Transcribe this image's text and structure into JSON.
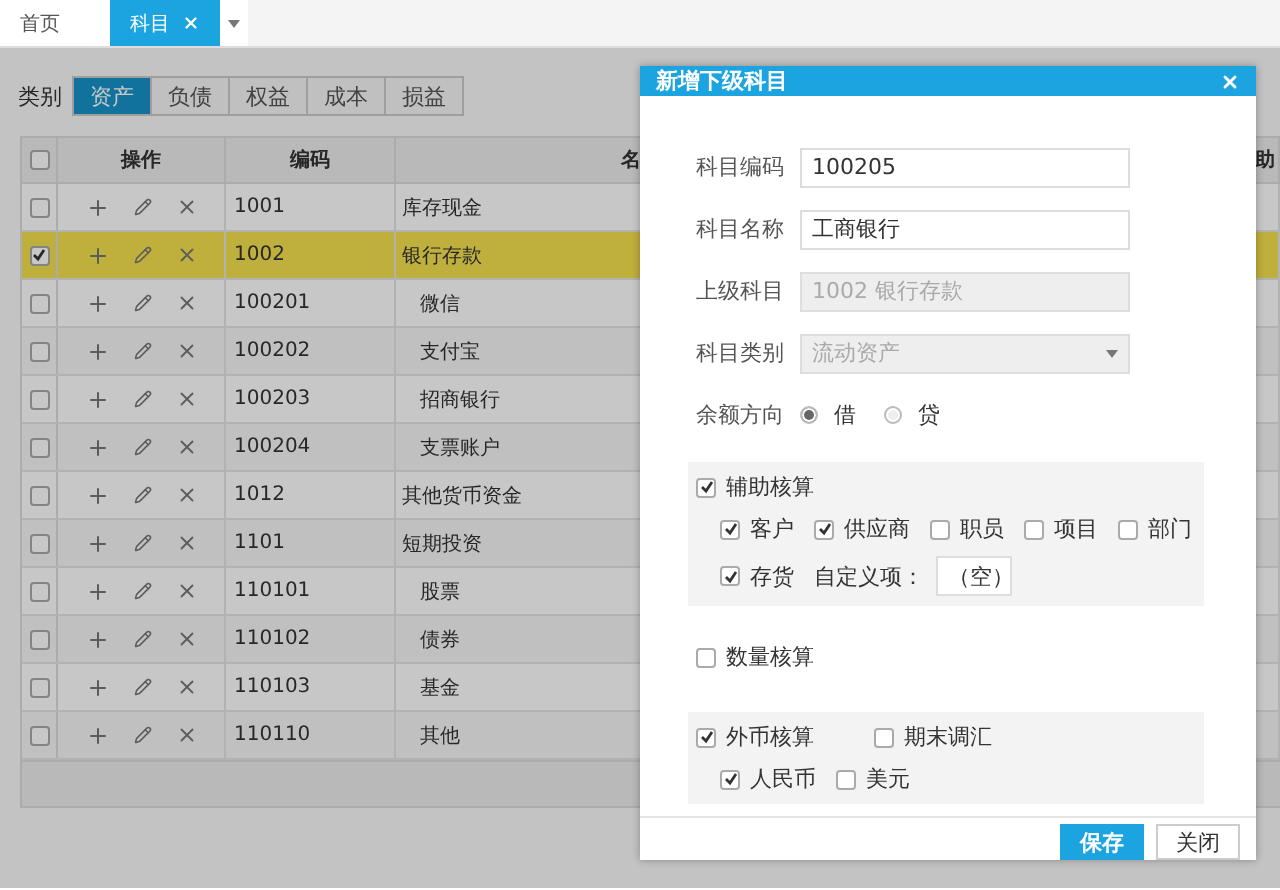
{
  "tabs": [
    {
      "label": "首页",
      "selected": false,
      "closable": false
    },
    {
      "label": "科目",
      "selected": true,
      "closable": true
    }
  ],
  "category_filter": {
    "label": "类别",
    "options": [
      {
        "label": "资产",
        "selected": true
      },
      {
        "label": "负债",
        "selected": false
      },
      {
        "label": "权益",
        "selected": false
      },
      {
        "label": "成本",
        "selected": false
      },
      {
        "label": "损益",
        "selected": false
      }
    ]
  },
  "table": {
    "all_checked": false,
    "columns": [
      "操作",
      "编码",
      "名",
      "助"
    ],
    "rows": [
      {
        "code": "1001",
        "name": "库存现金",
        "checked": false,
        "selected": false
      },
      {
        "code": "1002",
        "name": "银行存款",
        "checked": true,
        "selected": true,
        "children": [
          {
            "code": "100201",
            "name": "微信",
            "checked": false,
            "selected": false
          },
          {
            "code": "100202",
            "name": "支付宝",
            "checked": false,
            "selected": false
          },
          {
            "code": "100203",
            "name": "招商银行",
            "checked": false,
            "selected": false
          },
          {
            "code": "100204",
            "name": "支票账户",
            "checked": false,
            "selected": false
          }
        ]
      },
      {
        "code": "1012",
        "name": "其他货币资金",
        "checked": false,
        "selected": false
      },
      {
        "code": "1101",
        "name": "短期投资",
        "checked": false,
        "selected": false,
        "children": [
          {
            "code": "110101",
            "name": "股票",
            "checked": false,
            "selected": false
          },
          {
            "code": "110102",
            "name": "债券",
            "checked": false,
            "selected": false
          },
          {
            "code": "110103",
            "name": "基金",
            "checked": false,
            "selected": false
          },
          {
            "code": "110110",
            "name": "其他",
            "checked": false,
            "selected": false
          }
        ]
      }
    ]
  },
  "dialog": {
    "title": "新增下级科目",
    "fields": [
      {
        "kind": "text",
        "label": "科目编码",
        "value": "100205",
        "disabled": false
      },
      {
        "kind": "text",
        "label": "科目名称",
        "value": "工商银行",
        "disabled": false
      },
      {
        "kind": "text",
        "label": "上级科目",
        "value": "1002 银行存款",
        "disabled": true
      },
      {
        "kind": "select",
        "label": "科目类别",
        "value": "流动资产",
        "disabled": true
      },
      {
        "kind": "radio",
        "label": "余额方向",
        "options": [
          {
            "label": "借",
            "selected": true
          },
          {
            "label": "贷",
            "selected": false
          }
        ]
      }
    ],
    "sections": [
      {
        "label": "辅助核算",
        "checked": true,
        "lines": [
          [
            {
              "kind": "checkbox",
              "label": "客户",
              "checked": true
            },
            {
              "kind": "checkbox",
              "label": "供应商",
              "checked": true
            },
            {
              "kind": "checkbox",
              "label": "职员",
              "checked": false
            },
            {
              "kind": "checkbox",
              "label": "项目",
              "checked": false
            },
            {
              "kind": "checkbox",
              "label": "部门",
              "checked": false
            }
          ],
          [
            {
              "kind": "checkbox",
              "label": "存货",
              "checked": true
            },
            {
              "kind": "select",
              "label": "自定义项：",
              "value": "（空）"
            }
          ]
        ]
      },
      {
        "label": "数量核算",
        "checked": false
      },
      {
        "label": "外币核算",
        "checked": true,
        "extra": {
          "label": "期末调汇",
          "checked": false
        },
        "lines": [
          [
            {
              "kind": "checkbox",
              "label": "人民币",
              "checked": true
            },
            {
              "kind": "checkbox",
              "label": "美元",
              "checked": false
            }
          ]
        ]
      }
    ],
    "buttons": [
      {
        "label": "保存",
        "kind": "primary"
      },
      {
        "label": "关闭",
        "kind": "default"
      }
    ]
  }
}
